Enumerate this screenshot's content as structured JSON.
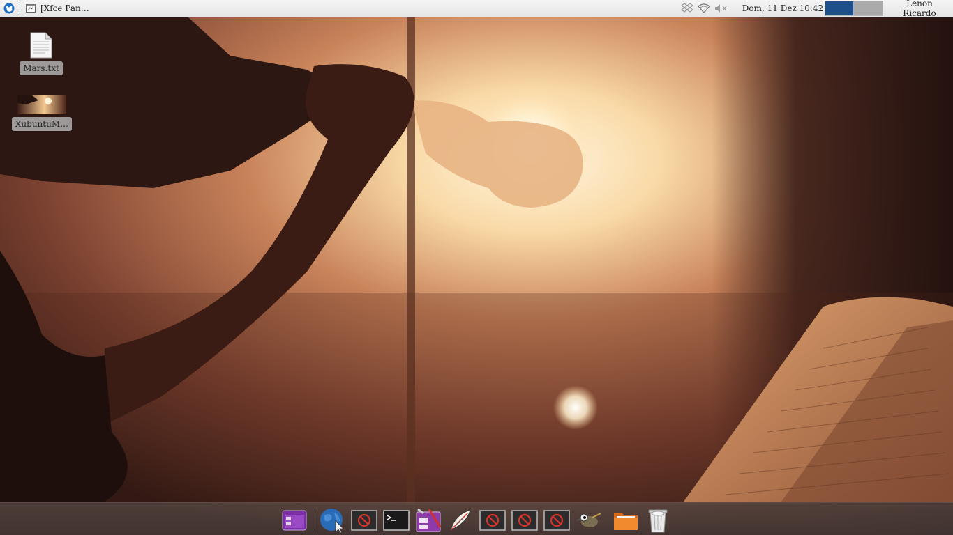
{
  "top_panel": {
    "menu_icon": "xfce-mouse-icon",
    "task": {
      "icon": "window-icon",
      "label": "[Xfce Pan…"
    },
    "tray": {
      "icons": [
        "dropbox-icon",
        "wifi-icon",
        "volume-muted-icon"
      ]
    },
    "clock": "Dom, 11 Dez 10:42",
    "workspaces": {
      "count": 2,
      "active_index": 0,
      "active_color": "#1e4f8a",
      "inactive_color": "#aaaaaa"
    },
    "user": "Lenon Ricardo"
  },
  "desktop": {
    "icons": [
      {
        "label": "Mars.txt",
        "icon": "text-file-icon"
      },
      {
        "label": "XubuntuM…",
        "icon": "image-thumbnail-icon"
      }
    ]
  },
  "dock": {
    "items": [
      {
        "name": "application-launcher",
        "icon": "purple-window-icon"
      },
      {
        "name": "web-browser",
        "icon": "globe-icon"
      },
      {
        "name": "missing-app-1",
        "icon": "no-entry-icon"
      },
      {
        "name": "terminal",
        "icon": "terminal-icon"
      },
      {
        "name": "settings-manager",
        "icon": "settings-window-icon"
      },
      {
        "name": "mail-client",
        "icon": "quill-icon"
      },
      {
        "name": "missing-app-2",
        "icon": "no-entry-icon"
      },
      {
        "name": "missing-app-3",
        "icon": "no-entry-icon"
      },
      {
        "name": "missing-app-4",
        "icon": "no-entry-icon"
      },
      {
        "name": "gimp",
        "icon": "gimp-icon"
      },
      {
        "name": "file-manager",
        "icon": "folder-icon"
      },
      {
        "name": "trash",
        "icon": "trash-icon"
      }
    ]
  },
  "colors": {
    "panel_bg": "#eeeeee",
    "dock_bg": "#5a4e4a",
    "no_entry_red": "#d8342c"
  }
}
